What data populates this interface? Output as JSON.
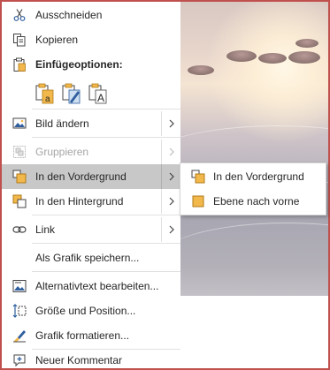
{
  "colors": {
    "frame_border": "#c0504d",
    "hover_background": "#c8c8c8",
    "disabled_text": "#a6a6a6",
    "icon_yellow": "#f2b84b",
    "icon_blue": "#2f5f9e"
  },
  "menu": {
    "cut": {
      "label": "Ausschneiden",
      "icon": "scissors-icon"
    },
    "copy": {
      "label": "Kopieren",
      "icon": "copy-icon"
    },
    "paste_options": {
      "label": "Einfügeoptionen:",
      "icon": "clipboard-icon",
      "options": [
        {
          "icon": "paste-keep-formatting-icon"
        },
        {
          "icon": "paste-picture-icon"
        },
        {
          "icon": "paste-text-only-icon"
        }
      ]
    },
    "change_picture": {
      "label": "Bild ändern",
      "icon": "change-picture-icon",
      "has_submenu": true
    },
    "group": {
      "label": "Gruppieren",
      "icon": "group-icon",
      "has_submenu": true,
      "disabled": true
    },
    "bring_to_front": {
      "label": "In den Vordergrund",
      "icon": "bring-to-front-icon",
      "has_submenu": true,
      "highlighted": true
    },
    "send_to_back": {
      "label": "In den Hintergrund",
      "icon": "send-to-back-icon",
      "has_submenu": true
    },
    "link": {
      "label": "Link",
      "icon": "link-icon",
      "has_submenu": true
    },
    "save_as_picture": {
      "label": "Als Grafik speichern..."
    },
    "alt_text": {
      "label": "Alternativtext bearbeiten...",
      "icon": "alt-text-icon"
    },
    "size_position": {
      "label": "Größe und Position...",
      "icon": "size-position-icon"
    },
    "format_picture": {
      "label": "Grafik formatieren...",
      "icon": "format-brush-icon"
    },
    "new_comment": {
      "label": "Neuer Kommentar",
      "icon": "new-comment-icon"
    }
  },
  "submenu": {
    "items": [
      {
        "label": "In den Vordergrund",
        "icon": "bring-to-front-icon"
      },
      {
        "label": "Ebene nach vorne",
        "icon": "bring-forward-icon"
      }
    ]
  }
}
